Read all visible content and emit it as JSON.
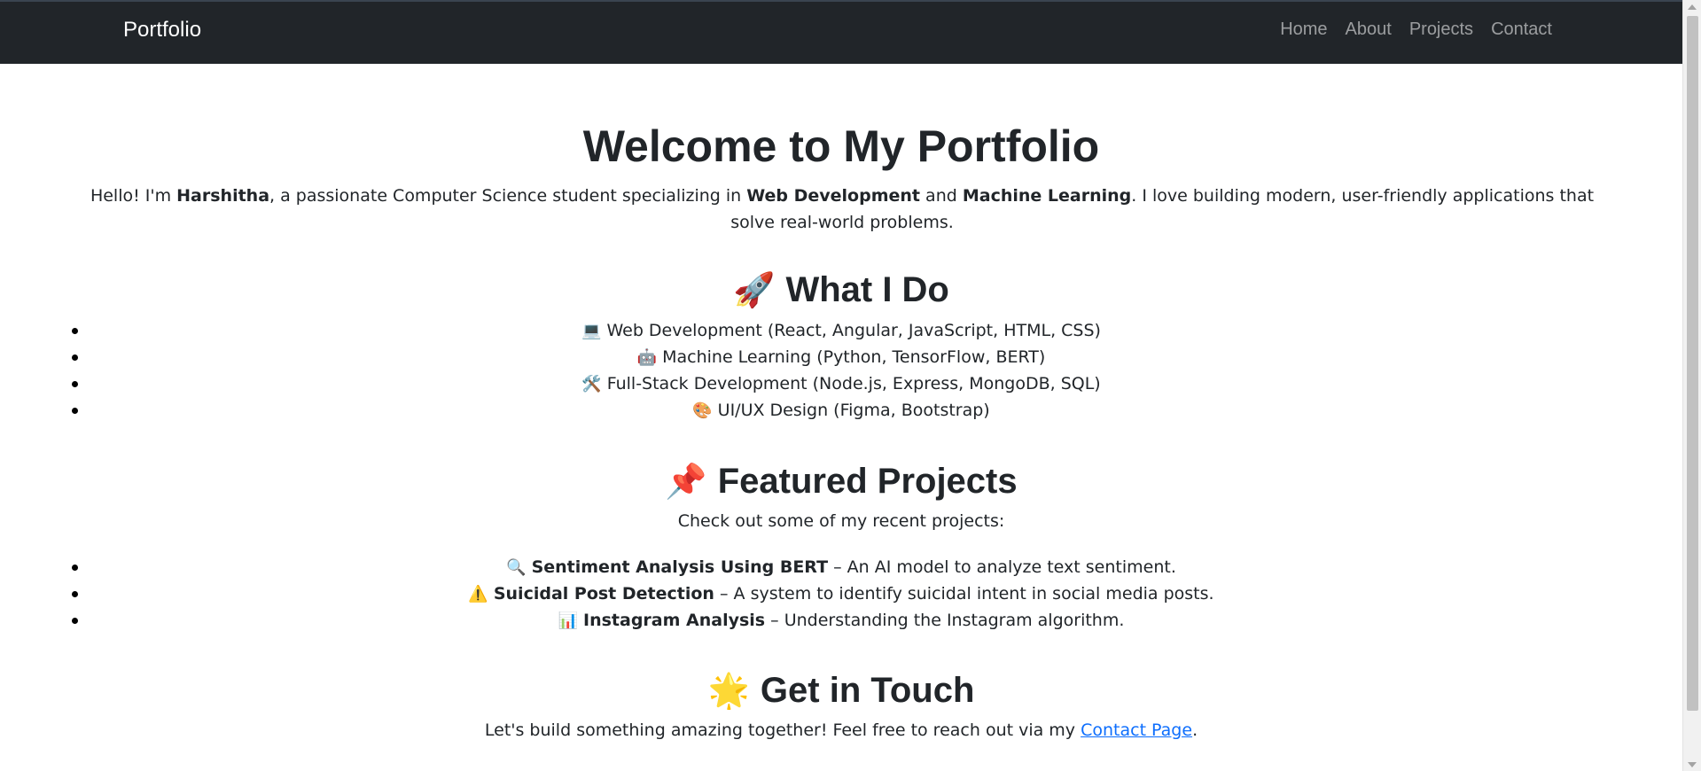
{
  "navbar": {
    "brand": "Portfolio",
    "links": [
      "Home",
      "About",
      "Projects",
      "Contact"
    ]
  },
  "hero": {
    "title": "Welcome to My Portfolio",
    "intro_pre": "Hello! I'm ",
    "name": "Harshitha",
    "intro_mid1": ", a passionate Computer Science student specializing in ",
    "skill1": "Web Development",
    "intro_and": " and ",
    "skill2": "Machine Learning",
    "intro_post": ". I love building modern, user-friendly applications that solve real-world problems."
  },
  "what_i_do": {
    "emoji": "🚀",
    "heading": "What I Do",
    "items": [
      {
        "icon": "💻",
        "text": "Web Development (React, Angular, JavaScript, HTML, CSS)"
      },
      {
        "icon": "🤖",
        "text": "Machine Learning (Python, TensorFlow, BERT)"
      },
      {
        "icon": "🛠️",
        "text": "Full-Stack Development (Node.js, Express, MongoDB, SQL)"
      },
      {
        "icon": "🎨",
        "text": "UI/UX Design (Figma, Bootstrap)"
      }
    ]
  },
  "projects": {
    "emoji": "📌",
    "heading": "Featured Projects",
    "subtitle": "Check out some of my recent projects:",
    "items": [
      {
        "icon": "🔍",
        "title": "Sentiment Analysis Using BERT",
        "desc": " – An AI model to analyze text sentiment."
      },
      {
        "icon": "⚠️",
        "title": "Suicidal Post Detection",
        "desc": " – A system to identify suicidal intent in social media posts."
      },
      {
        "icon": "📊",
        "title": "Instagram Analysis",
        "desc": " – Understanding the Instagram algorithm."
      }
    ]
  },
  "contact": {
    "emoji": "🌟",
    "heading": "Get in Touch",
    "text_pre": "Let's build something amazing together! Feel free to reach out via my ",
    "link_text": "Contact Page",
    "text_post": "."
  }
}
